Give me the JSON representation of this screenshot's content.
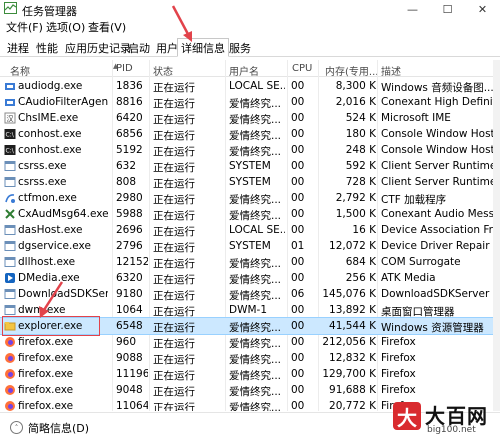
{
  "window": {
    "title": "任务管理器",
    "controls": [
      "—",
      "☐",
      "✕"
    ]
  },
  "menu": [
    "文件(F)",
    "选项(O)",
    "查看(V)"
  ],
  "tabs": [
    "进程",
    "性能",
    "应用历史记录",
    "启动",
    "用户",
    "详细信息",
    "服务"
  ],
  "active_tab": "详细信息",
  "columns": [
    "名称",
    "PID",
    "状态",
    "用户名",
    "CPU",
    "内存(专用...",
    "描述"
  ],
  "rows": [
    {
      "name": "audiodg.exe",
      "pid": "1836",
      "status": "正在运行",
      "user": "LOCAL SE...",
      "cpu": "00",
      "mem": "8,300 K",
      "desc": "Windows 音频设备图...",
      "icon": "audio-icon",
      "selected": false
    },
    {
      "name": "CAudioFilterAgent...",
      "pid": "8816",
      "status": "正在运行",
      "user": "爱情终究...",
      "cpu": "00",
      "mem": "2,016 K",
      "desc": "Conexant High Definit...",
      "icon": "audio-icon",
      "selected": false
    },
    {
      "name": "ChsIME.exe",
      "pid": "6420",
      "status": "正在运行",
      "user": "爱情终究...",
      "cpu": "00",
      "mem": "524 K",
      "desc": "Microsoft IME",
      "icon": "ime-icon",
      "selected": false
    },
    {
      "name": "conhost.exe",
      "pid": "6856",
      "status": "正在运行",
      "user": "爱情终究...",
      "cpu": "00",
      "mem": "180 K",
      "desc": "Console Window Host",
      "icon": "console-icon",
      "selected": false
    },
    {
      "name": "conhost.exe",
      "pid": "5192",
      "status": "正在运行",
      "user": "爱情终究...",
      "cpu": "00",
      "mem": "248 K",
      "desc": "Console Window Host",
      "icon": "console-icon",
      "selected": false
    },
    {
      "name": "csrss.exe",
      "pid": "632",
      "status": "正在运行",
      "user": "SYSTEM",
      "cpu": "00",
      "mem": "592 K",
      "desc": "Client Server Runtime ...",
      "icon": "system-icon",
      "selected": false
    },
    {
      "name": "csrss.exe",
      "pid": "808",
      "status": "正在运行",
      "user": "SYSTEM",
      "cpu": "00",
      "mem": "728 K",
      "desc": "Client Server Runtime ...",
      "icon": "system-icon",
      "selected": false
    },
    {
      "name": "ctfmon.exe",
      "pid": "2980",
      "status": "正在运行",
      "user": "爱情终究...",
      "cpu": "00",
      "mem": "2,792 K",
      "desc": "CTF 加载程序",
      "icon": "ctf-icon",
      "selected": false
    },
    {
      "name": "CxAudMsg64.exe",
      "pid": "5988",
      "status": "正在运行",
      "user": "爱情终究...",
      "cpu": "00",
      "mem": "1,500 K",
      "desc": "Conexant Audio Mess...",
      "icon": "tools-icon",
      "selected": false
    },
    {
      "name": "dasHost.exe",
      "pid": "2696",
      "status": "正在运行",
      "user": "LOCAL SE...",
      "cpu": "00",
      "mem": "16 K",
      "desc": "Device Association Fr...",
      "icon": "system-icon",
      "selected": false
    },
    {
      "name": "dgservice.exe",
      "pid": "2796",
      "status": "正在运行",
      "user": "SYSTEM",
      "cpu": "01",
      "mem": "12,072 K",
      "desc": "Device Driver Repair ...",
      "icon": "system-icon",
      "selected": false
    },
    {
      "name": "dllhost.exe",
      "pid": "12152",
      "status": "正在运行",
      "user": "爱情终究...",
      "cpu": "00",
      "mem": "684 K",
      "desc": "COM Surrogate",
      "icon": "system-icon",
      "selected": false
    },
    {
      "name": "DMedia.exe",
      "pid": "6320",
      "status": "正在运行",
      "user": "爱情终究...",
      "cpu": "00",
      "mem": "256 K",
      "desc": "ATK Media",
      "icon": "media-icon",
      "selected": false
    },
    {
      "name": "DownloadSDKServ...",
      "pid": "9180",
      "status": "正在运行",
      "user": "爱情终究...",
      "cpu": "06",
      "mem": "145,076 K",
      "desc": "DownloadSDKServer",
      "icon": "system-icon",
      "selected": false
    },
    {
      "name": "dwm.exe",
      "pid": "1064",
      "status": "正在运行",
      "user": "DWM-1",
      "cpu": "00",
      "mem": "13,892 K",
      "desc": "桌面窗口管理器",
      "icon": "system-icon",
      "selected": false
    },
    {
      "name": "explorer.exe",
      "pid": "6548",
      "status": "正在运行",
      "user": "爱情终究...",
      "cpu": "00",
      "mem": "41,544 K",
      "desc": "Windows 资源管理器",
      "icon": "folder-icon",
      "selected": true
    },
    {
      "name": "firefox.exe",
      "pid": "960",
      "status": "正在运行",
      "user": "爱情终究...",
      "cpu": "00",
      "mem": "212,056 K",
      "desc": "Firefox",
      "icon": "firefox-icon",
      "selected": false
    },
    {
      "name": "firefox.exe",
      "pid": "9088",
      "status": "正在运行",
      "user": "爱情终究...",
      "cpu": "00",
      "mem": "12,832 K",
      "desc": "Firefox",
      "icon": "firefox-icon",
      "selected": false
    },
    {
      "name": "firefox.exe",
      "pid": "11196",
      "status": "正在运行",
      "user": "爱情终究...",
      "cpu": "00",
      "mem": "129,700 K",
      "desc": "Firefox",
      "icon": "firefox-icon",
      "selected": false
    },
    {
      "name": "firefox.exe",
      "pid": "9048",
      "status": "正在运行",
      "user": "爱情终究...",
      "cpu": "00",
      "mem": "91,688 K",
      "desc": "Firefox",
      "icon": "firefox-icon",
      "selected": false
    },
    {
      "name": "firefox.exe",
      "pid": "11064",
      "status": "正在运行",
      "user": "爱情终究...",
      "cpu": "00",
      "mem": "20,772 K",
      "desc": "Firefox",
      "icon": "firefox-icon",
      "selected": false
    }
  ],
  "statusbar": {
    "label": "简略信息(D)"
  },
  "watermark": {
    "text": "大百网",
    "domain": "big100.net",
    "badge": "大"
  },
  "colors": {
    "selection": "#cce8ff",
    "annotation": "#e2434b",
    "watermark": "#d92b2f"
  }
}
